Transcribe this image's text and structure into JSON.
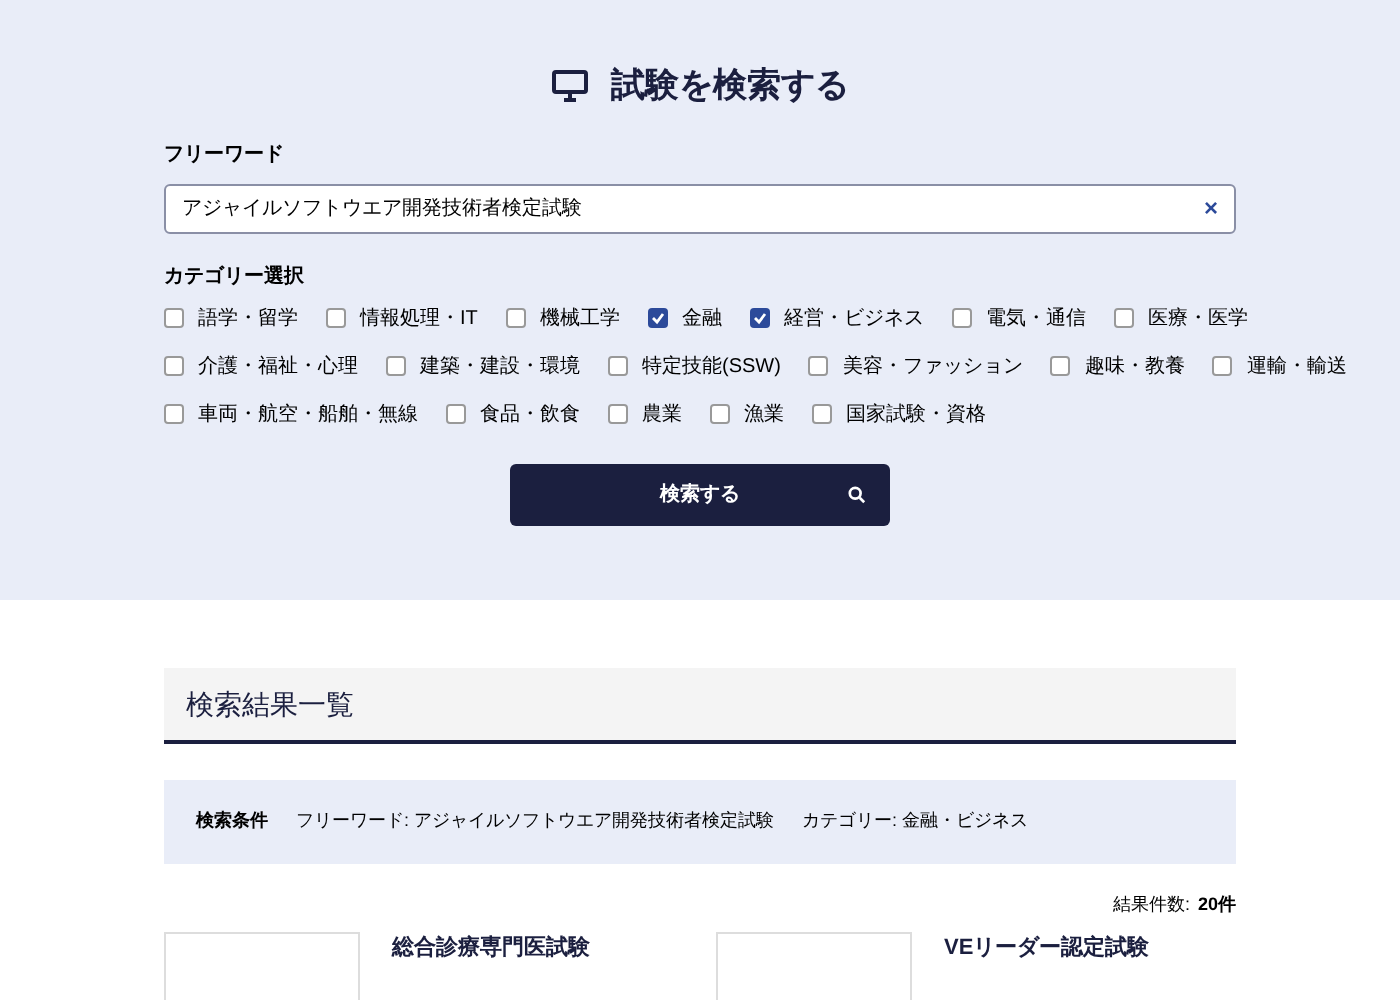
{
  "search": {
    "title": "試験を検索する",
    "freeword_label": "フリーワード",
    "freeword_value": "アジャイルソフトウエア開発技術者検定試験",
    "clear_button": "×",
    "category_label": "カテゴリー選択",
    "categories": [
      {
        "label": "語学・留学",
        "checked": false
      },
      {
        "label": "情報処理・IT",
        "checked": false
      },
      {
        "label": "機械工学",
        "checked": false
      },
      {
        "label": "金融",
        "checked": true
      },
      {
        "label": "経営・ビジネス",
        "checked": true
      },
      {
        "label": "電気・通信",
        "checked": false
      },
      {
        "label": "医療・医学",
        "checked": false
      },
      {
        "label": "介護・福祉・心理",
        "checked": false
      },
      {
        "label": "建築・建設・環境",
        "checked": false
      },
      {
        "label": "特定技能(SSW)",
        "checked": false
      },
      {
        "label": "美容・ファッション",
        "checked": false
      },
      {
        "label": "趣味・教養",
        "checked": false
      },
      {
        "label": "運輸・輸送",
        "checked": false
      },
      {
        "label": "車両・航空・船舶・無線",
        "checked": false
      },
      {
        "label": "食品・飲食",
        "checked": false
      },
      {
        "label": "農業",
        "checked": false
      },
      {
        "label": "漁業",
        "checked": false
      },
      {
        "label": "国家試験・資格",
        "checked": false
      }
    ],
    "submit_button": "検索する"
  },
  "results": {
    "title": "検索結果一覧",
    "conditions_label": "検索条件",
    "conditions": [
      "フリーワード: アジャイルソフトウエア開発技術者検定試験",
      "カテゴリー: 金融・ビジネス"
    ],
    "count_label": "結果件数:",
    "count_value": "20件",
    "items": [
      {
        "title": "総合診療専門医試験"
      },
      {
        "title": "VEリーダー認定試験"
      }
    ]
  }
}
